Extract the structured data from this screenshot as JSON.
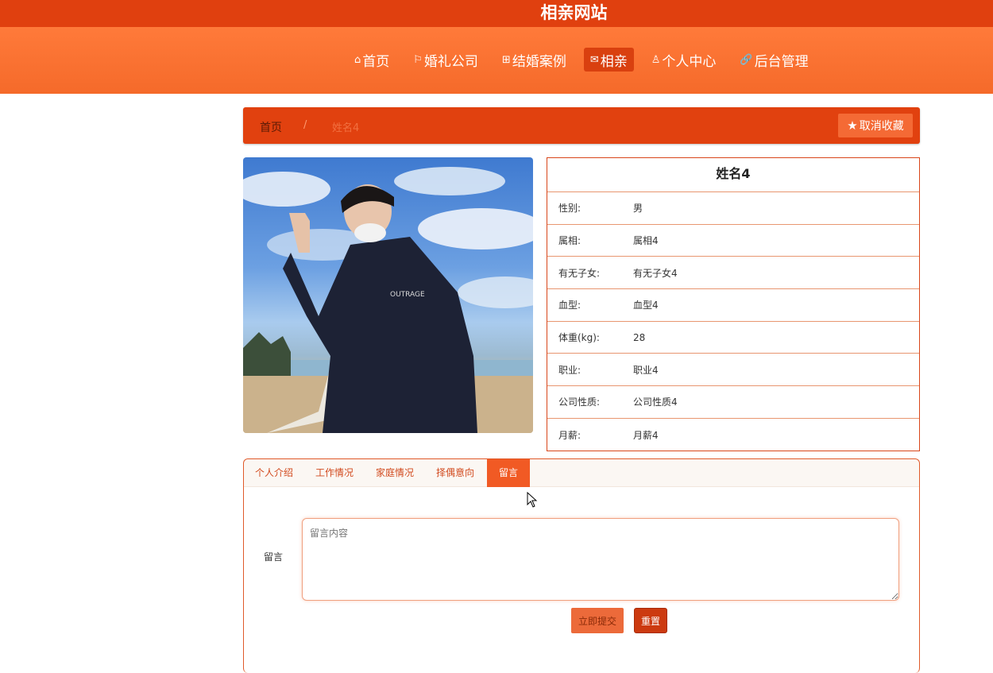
{
  "site": {
    "title": "相亲网站"
  },
  "nav": {
    "items": [
      {
        "icon": "⌂",
        "icon_name": "home-icon",
        "label": "首页"
      },
      {
        "icon": "⚐",
        "icon_name": "flag-icon",
        "label": "婚礼公司"
      },
      {
        "icon": "⊞",
        "icon_name": "gift-icon",
        "label": "结婚案例"
      },
      {
        "icon": "✉",
        "icon_name": "mail-icon",
        "label": "相亲"
      },
      {
        "icon": "♙",
        "icon_name": "user-icon",
        "label": "个人中心"
      },
      {
        "icon": "🔗",
        "icon_name": "link-icon",
        "label": "后台管理"
      }
    ],
    "active": "相亲"
  },
  "breadcrumb": {
    "home": "首页",
    "separator": "/",
    "current": "姓名4"
  },
  "favorite_button": {
    "label": "取消收藏"
  },
  "profile": {
    "name": "姓名4",
    "fields": [
      {
        "label": "性别:",
        "value": "男"
      },
      {
        "label": "属相:",
        "value": "属相4"
      },
      {
        "label": "有无子女:",
        "value": "有无子女4"
      },
      {
        "label": "血型:",
        "value": "血型4"
      },
      {
        "label": "体重(kg):",
        "value": "28"
      },
      {
        "label": "职业:",
        "value": "职业4"
      },
      {
        "label": "公司性质:",
        "value": "公司性质4"
      },
      {
        "label": "月薪:",
        "value": "月薪4"
      }
    ]
  },
  "tabs": [
    "个人介绍",
    "工作情况",
    "家庭情况",
    "择偶意向",
    "留言"
  ],
  "active_tab": "留言",
  "message_form": {
    "label": "留言",
    "placeholder": "留言内容",
    "submit_label": "立即提交",
    "reset_label": "重置"
  },
  "colors": {
    "primary": "#e0400f",
    "nav": "#f56a2a",
    "accent": "#f15a24"
  }
}
